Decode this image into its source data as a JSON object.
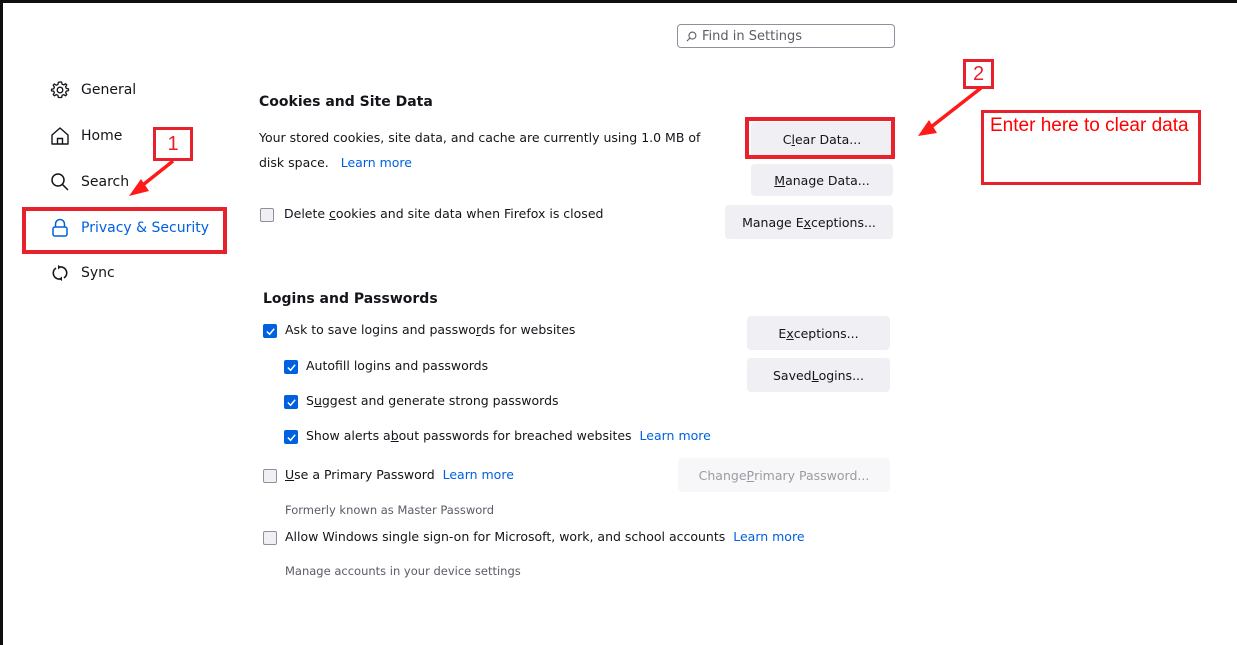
{
  "search": {
    "placeholder": "Find in Settings",
    "icon": "search-icon"
  },
  "sidebar": {
    "items": [
      {
        "label": "General",
        "icon": "gear-icon",
        "active": false
      },
      {
        "label": "Home",
        "icon": "home-icon",
        "active": false
      },
      {
        "label": "Search",
        "icon": "search-icon",
        "active": false
      },
      {
        "label": "Privacy & Security",
        "icon": "lock-icon",
        "active": true
      },
      {
        "label": "Sync",
        "icon": "sync-icon",
        "active": false
      }
    ]
  },
  "cookies": {
    "title": "Cookies and Site Data",
    "usage_line1": "Your stored cookies, site data, and cache are currently using 1.0 MB of",
    "usage_line2": "disk space.",
    "learn_more": "Learn more",
    "delete_on_close": {
      "pre": "Delete ",
      "u": "c",
      "post": "ookies and site data when Firefox is closed",
      "checked": false
    },
    "buttons": {
      "clear_data": {
        "pre": "C",
        "u": "l",
        "post": "ear Data..."
      },
      "manage_data": {
        "pre": "",
        "u": "M",
        "post": "anage Data..."
      },
      "manage_exceptions": {
        "pre": "Manage E",
        "u": "x",
        "post": "ceptions..."
      }
    }
  },
  "logins": {
    "title": "Logins and Passwords",
    "ask_save": {
      "pre": "Ask to save logins and passwo",
      "u": "r",
      "post": "ds for websites",
      "checked": true
    },
    "autofill": {
      "pre": "Autof",
      "u": "i",
      "post": "ll logins and passwords",
      "checked": true
    },
    "suggest": {
      "pre": "S",
      "u": "u",
      "post": "ggest and generate strong passwords",
      "checked": true
    },
    "alerts": {
      "pre": "Show alerts a",
      "u": "b",
      "post": "out passwords for breached websites",
      "checked": true,
      "learn_more": "Learn more"
    },
    "primary": {
      "pre": "",
      "u": "U",
      "post": "se a Primary Password",
      "checked": false,
      "learn_more": "Learn more",
      "note": "Formerly known as Master Password"
    },
    "sso": {
      "label": "Allow Windows single sign-on for Microsoft, work, and school accounts",
      "checked": false,
      "learn_more": "Learn more",
      "note": "Manage accounts in your device settings"
    },
    "buttons": {
      "exceptions": {
        "pre": "E",
        "u": "x",
        "post": "ceptions..."
      },
      "saved_logins": {
        "pre": "Saved ",
        "u": "L",
        "post": "ogins..."
      },
      "change_primary": {
        "pre": "Change ",
        "u": "P",
        "post": "rimary Password...",
        "disabled": true
      }
    }
  },
  "annotations": {
    "step1": "1",
    "step2": "2",
    "note": "Enter here to clear data",
    "color": "#e8222d"
  }
}
